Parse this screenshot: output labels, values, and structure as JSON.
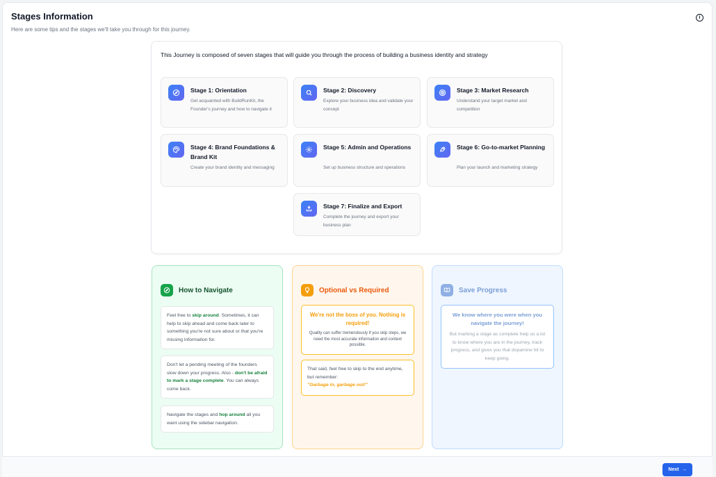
{
  "header": {
    "title": "Stages Information",
    "subtitle": "Here are some tips and the stages we'll take you through for this journey.",
    "info_icon": "i"
  },
  "intro": "This Journey is composed of seven stages that will guide you through the process of building a business identity and strategy",
  "stages": [
    {
      "title": "Stage 1: Orientation",
      "desc": "Get acquainted with BuildRunKit, the Founder's journey and how to navigate it",
      "icon": "compass-icon"
    },
    {
      "title": "Stage 2: Discovery",
      "desc": "Explore your business idea and validate your concept",
      "icon": "search-icon"
    },
    {
      "title": "Stage 3: Market Research",
      "desc": "Understand your target market and competition",
      "icon": "target-icon"
    },
    {
      "title": "Stage 4: Brand Foundations & Brand Kit",
      "desc": "Create your brand identity and messaging",
      "icon": "palette-icon"
    },
    {
      "title": "Stage 5: Admin and Operations",
      "desc": "Set up business structure and operations",
      "icon": "gear-icon"
    },
    {
      "title": "Stage 6: Go-to-market Planning",
      "desc": "Plan your launch and marketing strategy",
      "icon": "rocket-icon"
    },
    {
      "title": "Stage 7: Finalize and Export",
      "desc": "Complete the journey and export your business plan",
      "icon": "upload-icon"
    }
  ],
  "tips": {
    "navigate": {
      "title": "How to Navigate",
      "icon": "compass-icon",
      "box1": {
        "pre": "Feel free to ",
        "bold": "skip around",
        "post": ". Sometimes, it can help to skip ahead and come back later to something you're not sure about or that you're missing information for."
      },
      "box2": {
        "pre": "Don't let a pending meeting of the founders slow down your progress. Also - ",
        "bold": "don't be afraid to mark a stage complete",
        "post": ". You can always come back."
      },
      "box3": {
        "pre": "Navigate the stages and ",
        "bold": "hop around",
        "post": " all you want using the sidebar navigation."
      }
    },
    "optional": {
      "title": "Optional vs Required",
      "icon": "lightbulb-icon",
      "box1_heading": "We're not the boss of you. Nothing is required!",
      "box1_body": "Quality can suffer tremendously if you skip steps, we need the most accurate information and context possible.",
      "box2_body": "That said, feel free to skip to the end anytime, but remember:",
      "box2_quote": "\"Garbage in, garbage out!\""
    },
    "save": {
      "title": "Save Progress",
      "icon": "book-icon",
      "box1_heading": "We know where you were when you navigate the journey!",
      "box1_body": "But marking a stage as complete help us a lot to know where you are in the journey, track progress, and gives you that dopamine hit to keep going."
    }
  },
  "footer": {
    "next_label": "Next",
    "next_arrow": "→"
  },
  "colors": {
    "accent": "#2563eb",
    "green": "#15803d",
    "orange": "#f97316",
    "blue": "#7b9fd6"
  }
}
